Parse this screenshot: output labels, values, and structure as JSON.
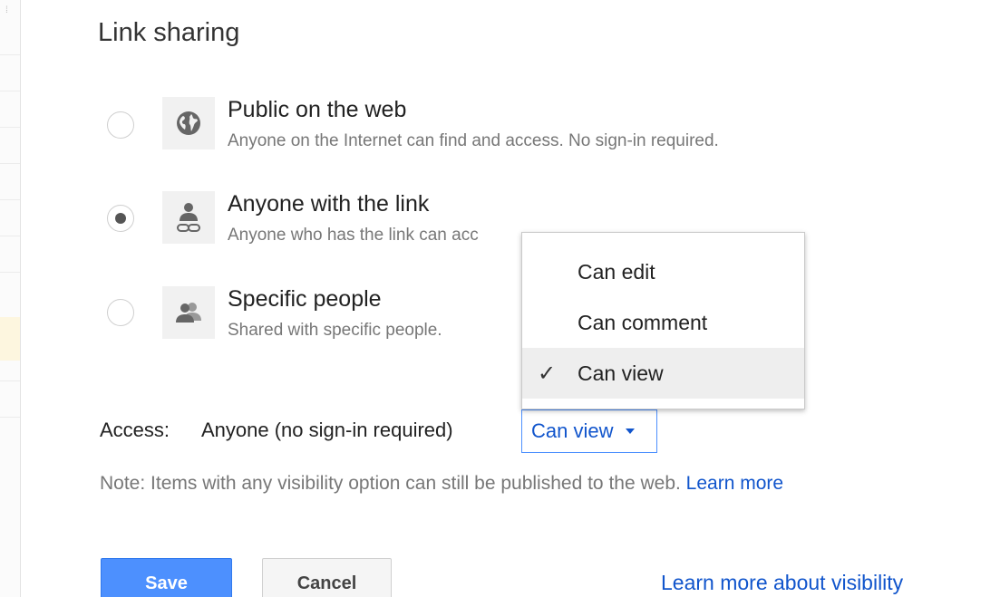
{
  "dialog": {
    "title": "Link sharing"
  },
  "options": [
    {
      "title": "Public on the web",
      "description": "Anyone on the Internet can find and access. No sign-in required.",
      "icon": "globe-icon",
      "selected": false
    },
    {
      "title": "Anyone with the link",
      "description": "Anyone who has the link can acc",
      "icon": "person-link-icon",
      "selected": true
    },
    {
      "title": "Specific people",
      "description": "Shared with specific people.",
      "icon": "people-icon",
      "selected": false
    }
  ],
  "access": {
    "label": "Access:",
    "value": "Anyone (no sign-in required)",
    "select_value": "Can view"
  },
  "dropdown": {
    "items": [
      {
        "label": "Can edit",
        "checked": false
      },
      {
        "label": "Can comment",
        "checked": false
      },
      {
        "label": "Can view",
        "checked": true
      }
    ],
    "check_glyph": "✓"
  },
  "note": {
    "text": "Note: Items with any visibility option can still be published to the web.",
    "link": "Learn more"
  },
  "buttons": {
    "save": "Save",
    "cancel": "Cancel"
  },
  "footer_link": "Learn more about visibility",
  "colors": {
    "accent": "#4d90fe",
    "link": "#1155cc",
    "muted_text": "#777777"
  }
}
